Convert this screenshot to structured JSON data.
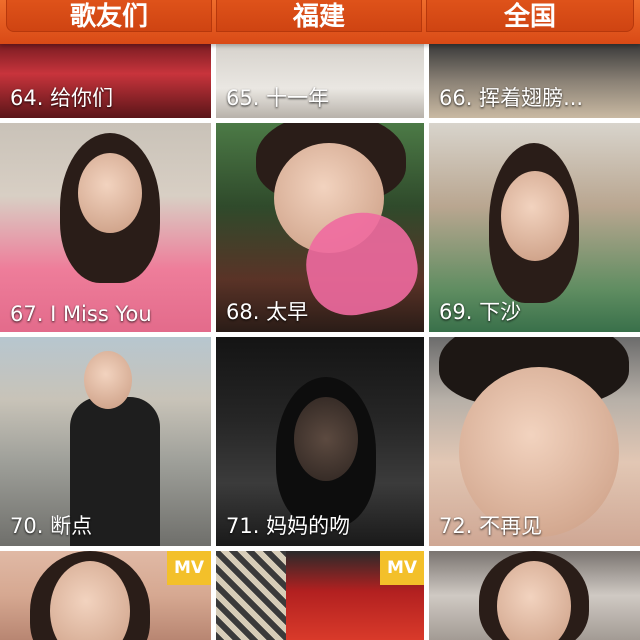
{
  "tabs": [
    {
      "label": "歌友们"
    },
    {
      "label": "福建"
    },
    {
      "label": "全国"
    }
  ],
  "items": [
    {
      "caption": "64. 给你们"
    },
    {
      "caption": "65. 十一年"
    },
    {
      "caption": "66. 挥着翅膀..."
    },
    {
      "caption": "67. I Miss You"
    },
    {
      "caption": "68. 太早"
    },
    {
      "caption": "69. 下沙"
    },
    {
      "caption": "70. 断点"
    },
    {
      "caption": "71. 妈妈的吻"
    },
    {
      "caption": "72. 不再见"
    },
    {
      "caption": ""
    },
    {
      "caption": ""
    },
    {
      "caption": ""
    }
  ],
  "badges": {
    "mv": "MV"
  },
  "colors": {
    "tabbar": "#e4561d",
    "mv_badge": "#f3c02a"
  }
}
